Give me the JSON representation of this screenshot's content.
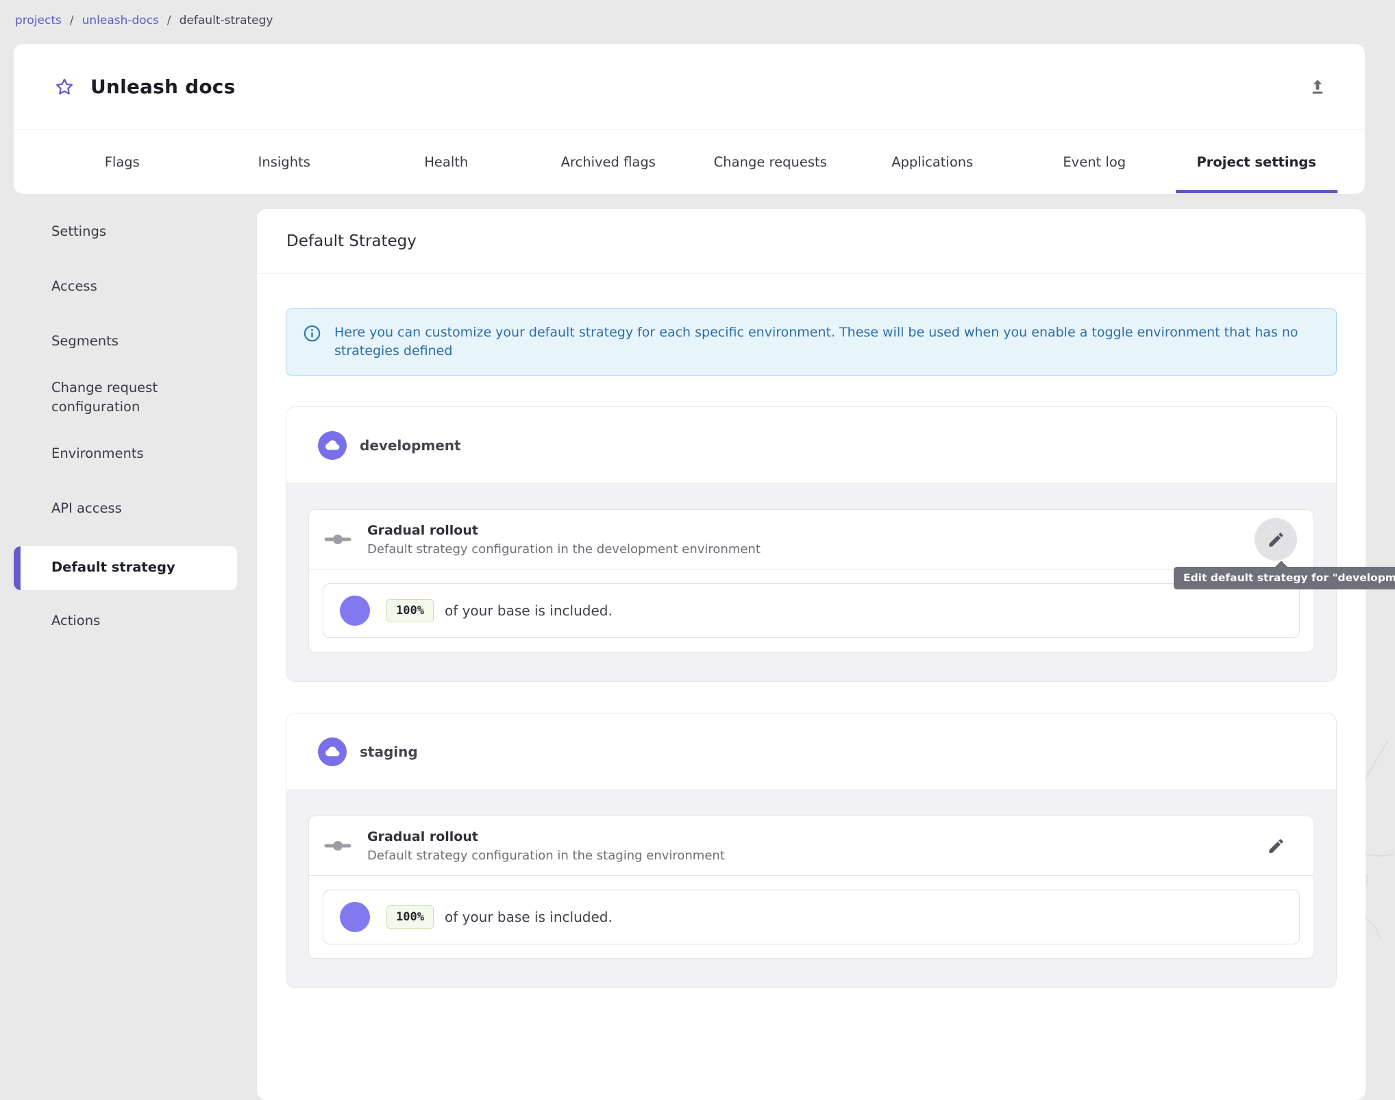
{
  "breadcrumb": {
    "separator": "/",
    "items": [
      {
        "label": "projects"
      },
      {
        "label": "unleash-docs"
      },
      {
        "label": "default-strategy"
      }
    ]
  },
  "header": {
    "title": "Unleash docs"
  },
  "tabs": [
    {
      "label": "Flags"
    },
    {
      "label": "Insights"
    },
    {
      "label": "Health"
    },
    {
      "label": "Archived flags"
    },
    {
      "label": "Change requests"
    },
    {
      "label": "Applications"
    },
    {
      "label": "Event log"
    },
    {
      "label": "Project settings"
    }
  ],
  "sidebar": {
    "items": [
      {
        "label": "Settings"
      },
      {
        "label": "Access"
      },
      {
        "label": "Segments"
      },
      {
        "label": "Change request configuration"
      },
      {
        "label": "Environments"
      },
      {
        "label": "API access"
      },
      {
        "label": "Default strategy"
      },
      {
        "label": "Actions"
      }
    ]
  },
  "main": {
    "title": "Default Strategy",
    "alert_text": "Here you can customize your default strategy for each specific environment. These will be used when you enable a toggle environment that has no strategies defined",
    "environments": [
      {
        "name": "development",
        "strategy_title": "Gradual rollout",
        "strategy_description": "Default strategy configuration in the development environment",
        "rollout_percent": "100%",
        "rollout_text": "of your base is included.",
        "edit_tooltip": "Edit default strategy for \"development\""
      },
      {
        "name": "staging",
        "strategy_title": "Gradual rollout",
        "strategy_description": "Default strategy configuration in the staging environment",
        "rollout_percent": "100%",
        "rollout_text": "of your base is included."
      }
    ]
  },
  "colors": {
    "primary": "#5e56c4",
    "link": "#6159c9",
    "env_avatar": "#796fe8",
    "rollout_circle": "#8179ee",
    "alert_bg": "#e7f4fb",
    "alert_text": "#2b6da8",
    "badge_bg": "#f4f9ec",
    "badge_border": "#c9e0aa",
    "tooltip_bg": "#70707a"
  }
}
